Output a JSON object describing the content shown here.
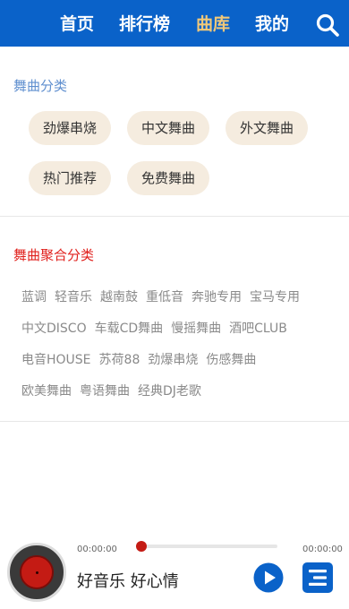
{
  "nav": {
    "tabs": [
      {
        "label": "首页"
      },
      {
        "label": "排行榜"
      },
      {
        "label": "曲库"
      },
      {
        "label": "我的"
      }
    ],
    "active_index": 2,
    "search_icon": "search-icon"
  },
  "colors": {
    "header_bg": "#0a62c9",
    "active_tab": "#f2c879",
    "section1_title": "#5f8fcf",
    "section2_title": "#e0201c",
    "pill_bg": "#f5ecdf",
    "accent": "#c41b14",
    "play_blue": "#0a62c9"
  },
  "categories": {
    "title": "舞曲分类",
    "items": [
      "劲爆串烧",
      "中文舞曲",
      "外文舞曲",
      "热门推荐",
      "免费舞曲"
    ]
  },
  "aggregate": {
    "title": "舞曲聚合分类",
    "rows": [
      [
        "蓝调",
        "轻音乐",
        "越南鼓",
        "重低音",
        "奔驰专用",
        "宝马专用"
      ],
      [
        "中文DISCO",
        "车载CD舞曲",
        "慢摇舞曲",
        "酒吧CLUB"
      ],
      [
        "电音HOUSE",
        "苏荷88",
        "劲爆串烧",
        "伤感舞曲"
      ],
      [
        "欧美舞曲",
        "粤语舞曲",
        "经典DJ老歌"
      ]
    ]
  },
  "player": {
    "current_time": "00:00:00",
    "total_time": "00:00:00",
    "progress": 0,
    "title": "好音乐 好心情",
    "icons": {
      "disc": "vinyl-disc-icon",
      "play": "play-icon",
      "list": "playlist-icon"
    }
  }
}
